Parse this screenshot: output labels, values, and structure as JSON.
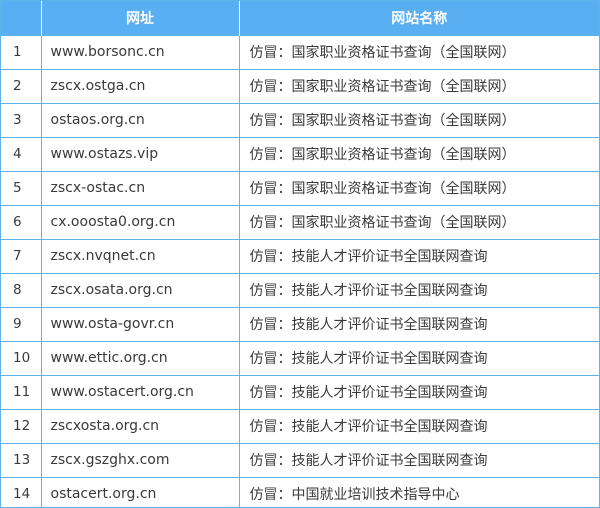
{
  "header": {
    "col_index": "",
    "col_url": "网址",
    "col_name": "网站名称"
  },
  "rows": [
    {
      "index": "1",
      "url": "www.borsonc.cn",
      "name": "仿冒：国家职业资格证书查询（全国联网）"
    },
    {
      "index": "2",
      "url": "zscx.ostga.cn",
      "name": "仿冒：国家职业资格证书查询（全国联网）"
    },
    {
      "index": "3",
      "url": "ostaos.org.cn",
      "name": "仿冒：国家职业资格证书查询（全国联网）"
    },
    {
      "index": "4",
      "url": "www.ostazs.vip",
      "name": "仿冒：国家职业资格证书查询（全国联网）"
    },
    {
      "index": "5",
      "url": "zscx-ostac.cn",
      "name": "仿冒：国家职业资格证书查询（全国联网）"
    },
    {
      "index": "6",
      "url": "cx.ooosta0.org.cn",
      "name": "仿冒：国家职业资格证书查询（全国联网）"
    },
    {
      "index": "7",
      "url": "zscx.nvqnet.cn",
      "name": "仿冒：技能人才评价证书全国联网查询"
    },
    {
      "index": "8",
      "url": "zscx.osata.org.cn",
      "name": "仿冒：技能人才评价证书全国联网查询"
    },
    {
      "index": "9",
      "url": "www.osta-govr.cn",
      "name": "仿冒：技能人才评价证书全国联网查询"
    },
    {
      "index": "10",
      "url": "www.ettic.org.cn",
      "name": "仿冒：技能人才评价证书全国联网查询"
    },
    {
      "index": "11",
      "url": "www.ostacert.org.cn",
      "name": "仿冒：技能人才评价证书全国联网查询"
    },
    {
      "index": "12",
      "url": "zscxosta.org.cn",
      "name": "仿冒：技能人才评价证书全国联网查询"
    },
    {
      "index": "13",
      "url": "zscx.gszghx.com",
      "name": "仿冒：技能人才评价证书全国联网查询"
    },
    {
      "index": "14",
      "url": "ostacert.org.cn",
      "name": "仿冒：中国就业培训技术指导中心"
    }
  ]
}
